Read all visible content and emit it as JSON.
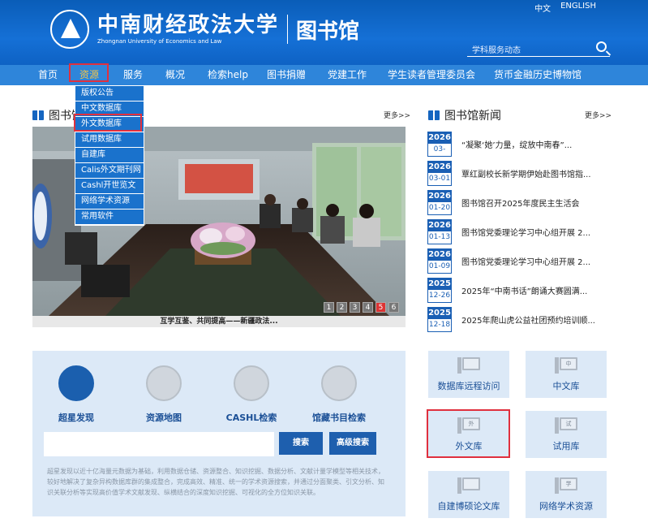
{
  "header": {
    "university_cn": "中南财经政法大学",
    "university_en": "Zhongnan University of Economics and Law",
    "library_title": "图书馆",
    "lang": [
      "中文",
      "ENGLISH"
    ],
    "search_placeholder": "学科服务动态"
  },
  "nav": {
    "items": [
      "首页",
      "资源",
      "服务",
      "概况",
      "检索help",
      "图书捐赠",
      "党建工作",
      "学生读者管理委员会",
      "货币金融历史博物馆"
    ],
    "highlight": "资源"
  },
  "dropdown": {
    "items": [
      "版权公告",
      "中文数据库",
      "外文数据库",
      "试用数据库",
      "自建库",
      "Calis外文期刊网",
      "Cashl开世览文",
      "网络学术资源",
      "常用软件"
    ]
  },
  "slider": {
    "section_title": "图书馆",
    "more": "更多>>",
    "numbers": [
      "1",
      "2",
      "3",
      "4",
      "5",
      "6"
    ],
    "current": 5,
    "caption": "互学互鉴、共同提高——新疆政法..."
  },
  "news": {
    "section_title": "图书馆新闻",
    "more": "更多>>",
    "items": [
      {
        "year": "2026",
        "md": "03-",
        "title": "“凝聚‘她’力量，绽放中南春”..."
      },
      {
        "year": "2026",
        "md": "03-01",
        "title": "覃红副校长新学期伊始赴图书馆指..."
      },
      {
        "year": "2026",
        "md": "01-20",
        "title": "图书馆召开2025年度民主生活会"
      },
      {
        "year": "2026",
        "md": "01-13",
        "title": "图书馆党委理论学习中心组开展 2..."
      },
      {
        "year": "2026",
        "md": "01-09",
        "title": "图书馆党委理论学习中心组开展 2..."
      },
      {
        "year": "2025",
        "md": "12-26",
        "title": "2025年“中南书话”朗诵大赛圆满..."
      },
      {
        "year": "2025",
        "md": "12-18",
        "title": "2025年爬山虎公益社团预约培训顺..."
      }
    ]
  },
  "discovery": {
    "tools": [
      "超星发现",
      "资源地图",
      "CASHL检索",
      "馆藏书目检索"
    ],
    "search_btn": "搜索",
    "advanced_btn": "高级搜索",
    "description": "超星发现以近十亿海量元数据为基础，利用数据仓储、资源整合、知识挖掘、数据分析、文献计量学模型等相关技术，较好地解决了复杂异构数据库群的集成整合，完成高效、精准、统一的学术资源搜索，并通过分面聚类、引文分析、知识关联分析等实现高价值学术文献发现、纵横结合的深度知识挖掘、可视化的全方位知识关联。"
  },
  "tiles": [
    {
      "label": "数据库远程访问",
      "glyph": ""
    },
    {
      "label": "中文库",
      "glyph": "中"
    },
    {
      "label": "外文库",
      "glyph": "外"
    },
    {
      "label": "试用库",
      "glyph": "试"
    },
    {
      "label": "自建博硕论文库",
      "glyph": ""
    },
    {
      "label": "网络学术资源",
      "glyph": "学"
    }
  ]
}
